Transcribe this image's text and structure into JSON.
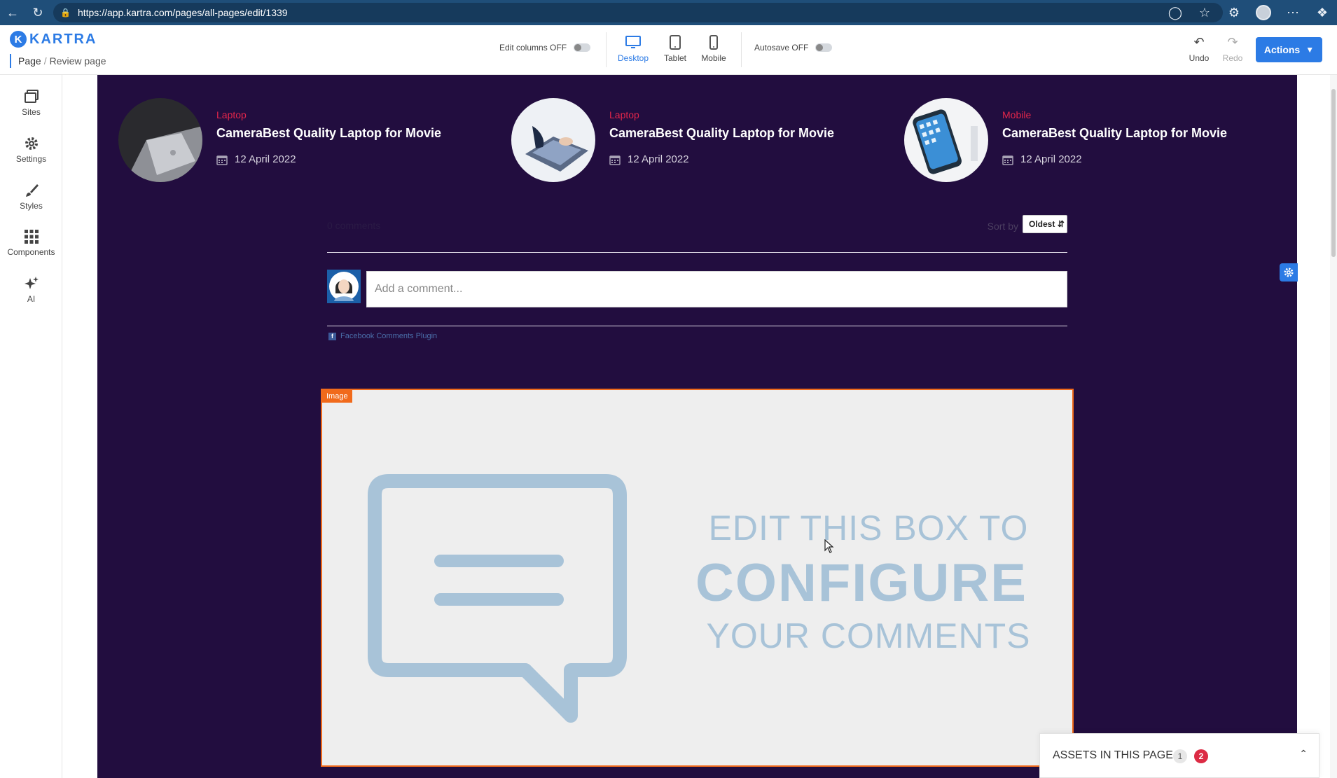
{
  "browser": {
    "url": "https://app.kartra.com/pages/all-pages/edit/1339"
  },
  "header": {
    "logo_text": "KARTRA",
    "logo_mark": "K",
    "breadcrumb_root": "Page",
    "breadcrumb_sep": "/",
    "breadcrumb_current": "Review page",
    "edit_columns_label": "Edit columns OFF",
    "autosave_label": "Autosave OFF",
    "devices": [
      {
        "label": "Desktop",
        "active": true
      },
      {
        "label": "Tablet",
        "active": false
      },
      {
        "label": "Mobile",
        "active": false
      }
    ],
    "undo_label": "Undo",
    "redo_label": "Redo",
    "actions_label": "Actions"
  },
  "sidebar": {
    "items": [
      {
        "label": "Sites",
        "icon": "sites-icon"
      },
      {
        "label": "Settings",
        "icon": "gear-icon"
      },
      {
        "label": "Styles",
        "icon": "brush-icon"
      },
      {
        "label": "Components",
        "icon": "grid-icon"
      },
      {
        "label": "AI",
        "icon": "sparkle-icon"
      }
    ]
  },
  "posts": [
    {
      "category": "Laptop",
      "title": "CameraBest Quality Laptop for Movie",
      "date": "12 April 2022"
    },
    {
      "category": "Laptop",
      "title": "CameraBest Quality Laptop for Movie",
      "date": "12 April 2022"
    },
    {
      "category": "Mobile",
      "title": "CameraBest Quality Laptop for Movie",
      "date": "12 April 2022"
    }
  ],
  "comments": {
    "count_label": "0 comments",
    "sort_label": "Sort by",
    "sort_value": "Oldest",
    "input_placeholder": "Add a comment...",
    "plugin_label": "Facebook Comments Plugin"
  },
  "image_block": {
    "tag": "Image",
    "line1": "EDIT THIS BOX TO",
    "line2": "CONFIGURE",
    "line3": "YOUR COMMENTS"
  },
  "assets": {
    "title": "ASSETS IN THIS PAGE",
    "count_gray": "1",
    "count_red": "2"
  },
  "colors": {
    "accent": "#2c7be5",
    "page_bg": "#220d3f",
    "category": "#e3264b",
    "selection": "#f16a1b"
  }
}
